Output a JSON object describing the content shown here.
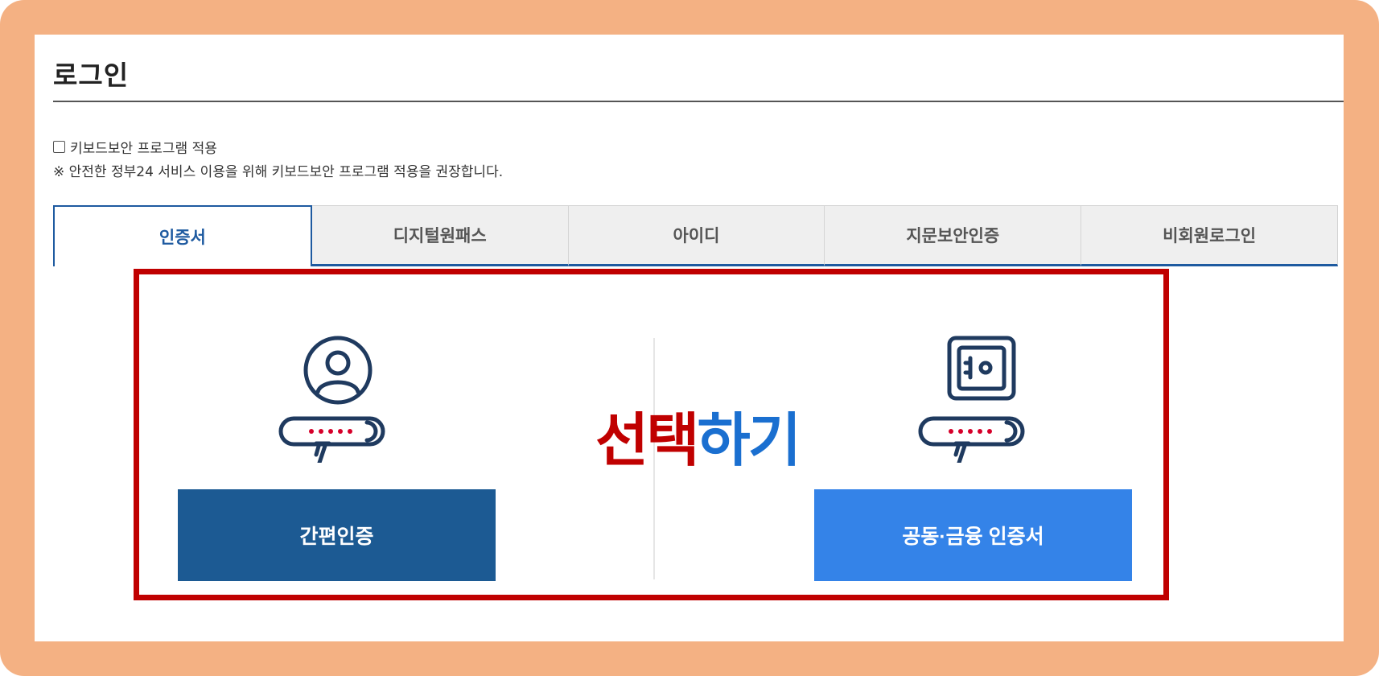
{
  "page": {
    "title": "로그인"
  },
  "keyboard_security": {
    "checkbox_label": "키보드보안 프로그램 적용",
    "notice": "※ 안전한 정부24 서비스 이용을 위해 키보드보안 프로그램 적용을 권장합니다."
  },
  "tabs": [
    {
      "label": "인증서",
      "active": true
    },
    {
      "label": "디지털원패스",
      "active": false
    },
    {
      "label": "아이디",
      "active": false
    },
    {
      "label": "지문보안인증",
      "active": false
    },
    {
      "label": "비회원로그인",
      "active": false
    }
  ],
  "options": {
    "simple_auth_label": "간편인증",
    "joint_cert_label": "공동·금융 인증서"
  },
  "annotation": {
    "part_red": "선택",
    "part_blue": "하기"
  },
  "colors": {
    "frame": "#f4b183",
    "accent_dark_blue": "#1c5a93",
    "accent_light_blue": "#3483e8",
    "highlight_red": "#c00000",
    "tab_active": "#1e5aa0"
  }
}
